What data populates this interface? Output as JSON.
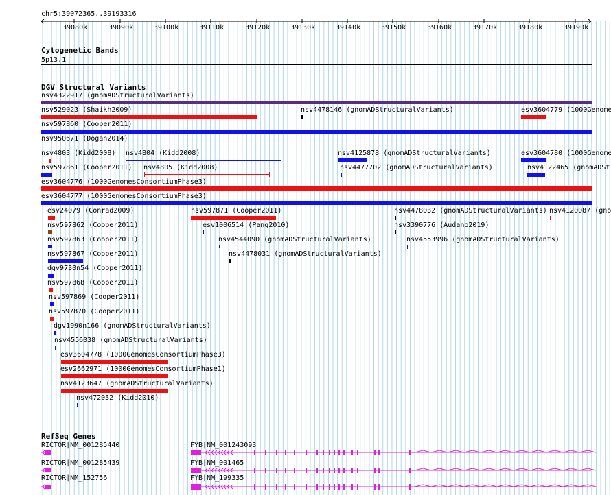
{
  "ruler": {
    "location": "chr5:39072365..39193316",
    "ticks": [
      "39080k",
      "39090k",
      "39100k",
      "39110k",
      "39120k",
      "39130k",
      "39140k",
      "39150k",
      "39160k",
      "39170k",
      "39180k",
      "39190k"
    ]
  },
  "cytoband": {
    "title": "Cytogenetic Bands",
    "band": "5p13.1"
  },
  "dgv": {
    "title": "DGV Structural Variants",
    "features": [
      {
        "label": "nsv4322917 (gnomADStructuralVariants)",
        "color": "#5b2c83"
      },
      {
        "label": "nsv529023 (Shaikh2009)",
        "color": "#ee1111"
      },
      {
        "label": "nsv4478146 (gnomADStructuralVariants)",
        "color": "#000000"
      },
      {
        "label": "esv3604779 (1000Genome",
        "color": "#ee1111"
      },
      {
        "label": "nsv597860 (Cooper2011)",
        "color": "#1111ee"
      },
      {
        "label": "nsv950671 (Dogan2014)",
        "color": "#1111ee"
      },
      {
        "label": "nsv4803 (Kidd2008)",
        "color": "#ee1111"
      },
      {
        "label": "nsv4804 (Kidd2008)",
        "color": "#1111ee"
      },
      {
        "label": "nsv4125878 (gnomADStructuralVariants)",
        "color": "#1111ee"
      },
      {
        "label": "esv3604780 (1000Genome",
        "color": "#1111ee"
      },
      {
        "label": "nsv597861 (Cooper2011)",
        "color": "#1111ee"
      },
      {
        "label": "nsv4805 (Kidd2008)",
        "color": "#ee1111"
      },
      {
        "label": "nsv4477702 (gnomADStructuralVariants)",
        "color": "#1111ee"
      },
      {
        "label": "nsv4122465 (gnomADSt",
        "color": "#1111ee"
      },
      {
        "label": "esv3604776 (1000GenomesConsortiumPhase3)",
        "color": "#ee1111"
      },
      {
        "label": "esv3604777 (1000GenomesConsortiumPhase3)",
        "color": "#1111ee"
      },
      {
        "label": "esv24079 (Conrad2009)",
        "color": "#ee1111"
      },
      {
        "label": "nsv597871 (Cooper2011)",
        "color": "#ee1111"
      },
      {
        "label": "nsv4478032 (gnomADStructuralVariants)",
        "color": "#000000"
      },
      {
        "label": "nsv4120087 (gno",
        "color": "#ee1111"
      },
      {
        "label": "nsv597862 (Cooper2011)",
        "color": "#8b4513"
      },
      {
        "label": "esv1006514 (Pang2010)",
        "color": "#1111ee"
      },
      {
        "label": "nsv3390776 (Audano2019)",
        "color": "#000000"
      },
      {
        "label": "nsv597863 (Cooper2011)",
        "color": "#1111ee"
      },
      {
        "label": "nsv4544090 (gnomADStructuralVariants)",
        "color": "#1111ee"
      },
      {
        "label": "nsv4553996 (gnomADStructuralVariants)",
        "color": "#1111ee"
      },
      {
        "label": "nsv597867 (Cooper2011)",
        "color": "#1111ee"
      },
      {
        "label": "nsv4478031 (gnomADStructuralVariants)",
        "color": "#000000"
      },
      {
        "label": "dgv9730n54 (Cooper2011)",
        "color": "#1111ee"
      },
      {
        "label": "nsv597868 (Cooper2011)",
        "color": "#ee1111"
      },
      {
        "label": "nsv597869 (Cooper2011)",
        "color": "#1111ee"
      },
      {
        "label": "nsv597870 (Cooper2011)",
        "color": "#ee1111"
      },
      {
        "label": "dgv1990n166 (gnomADStructuralVariants)",
        "color": "#1111ee"
      },
      {
        "label": "nsv4556038 (gnomADStructuralVariants)",
        "color": "#1111ee"
      },
      {
        "label": "esv3604778 (1000GenomesConsortiumPhase3)",
        "color": "#ee1111"
      },
      {
        "label": "esv2662971 (1000GenomesConsortiumPhase1)",
        "color": "#ee1111"
      },
      {
        "label": "nsv4123647 (gnomADStructuralVariants)",
        "color": "#ee1111"
      },
      {
        "label": "nsv472032 (Kidd2010)",
        "color": "#1111ee"
      }
    ]
  },
  "refseq": {
    "title": "RefSeq Genes",
    "color": "#e020e0",
    "genes": [
      {
        "label": "RICTOR|NM_001285440"
      },
      {
        "label": "FYB|NM_001243093"
      },
      {
        "label": "RICTOR|NM_001285439"
      },
      {
        "label": "FYB|NM_001465"
      },
      {
        "label": "RICTOR|NM_152756"
      },
      {
        "label": "FYB|NM_199335"
      }
    ]
  }
}
